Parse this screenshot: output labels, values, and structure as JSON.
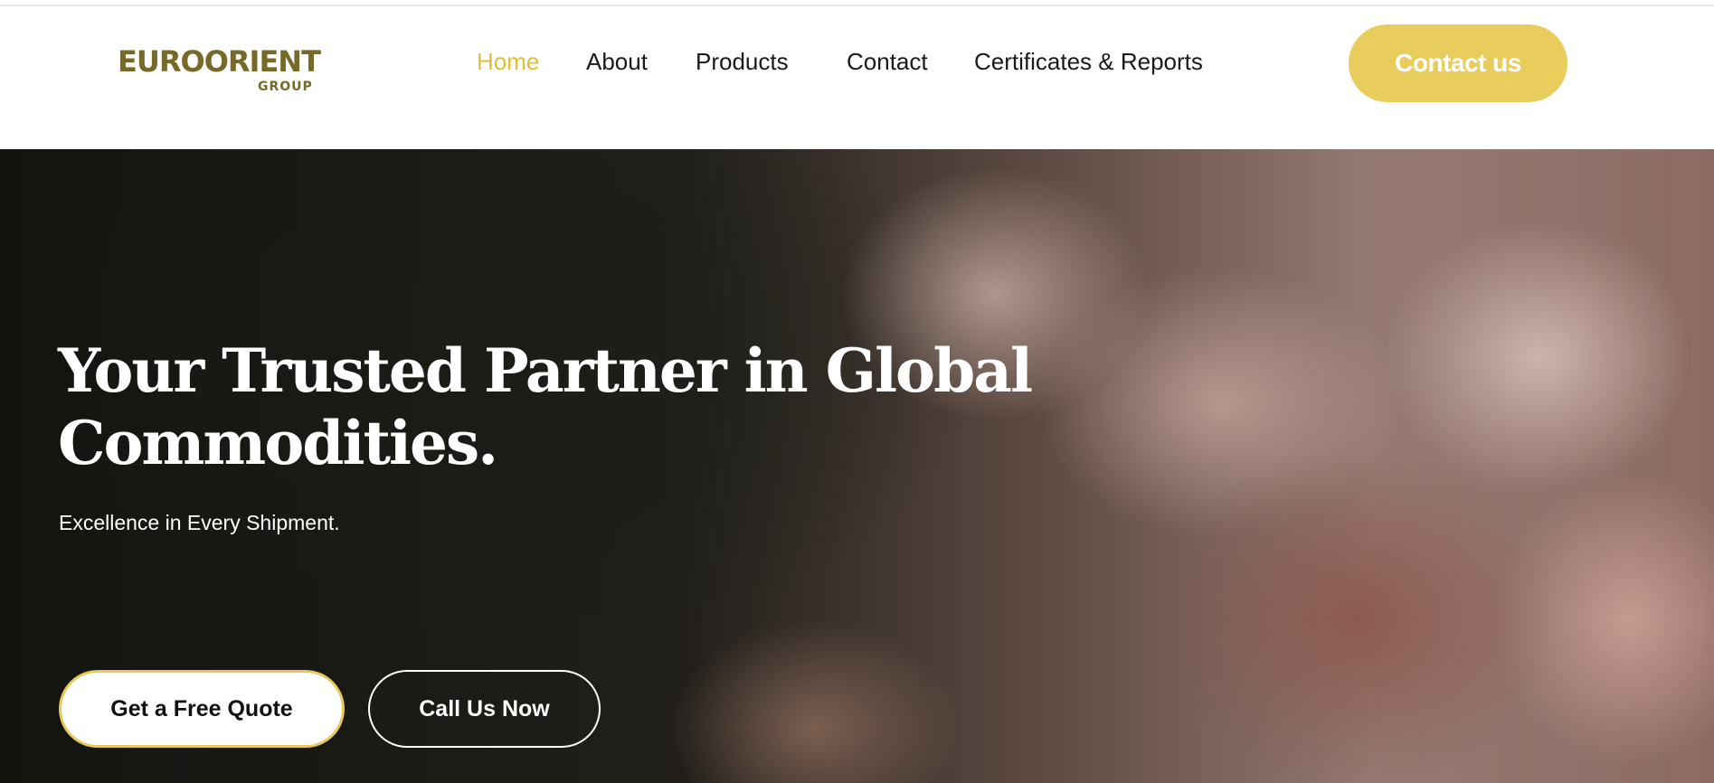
{
  "brand": {
    "logo_text": "EUROORIENT",
    "logo_subtext": "GROUP",
    "logo_color": "#776a28"
  },
  "nav": {
    "items": [
      {
        "label": "Home",
        "active": true
      },
      {
        "label": "About",
        "active": false
      },
      {
        "label": "Products",
        "active": false
      },
      {
        "label": "Contact",
        "active": false
      },
      {
        "label": "Certificates & Reports",
        "active": false
      }
    ],
    "active_color": "#e1bd3c"
  },
  "header": {
    "cta_label": "Contact us",
    "cta_color": "#e9cd5c"
  },
  "hero": {
    "title_line1": "Your Trusted Partner in Global",
    "title_line2": "Commodities.",
    "subtitle": "Excellence in Every Shipment.",
    "primary_button": "Get a Free Quote",
    "secondary_button": "Call Us Now",
    "background_image": "close-up of pink salt crystals and a dark stone"
  }
}
